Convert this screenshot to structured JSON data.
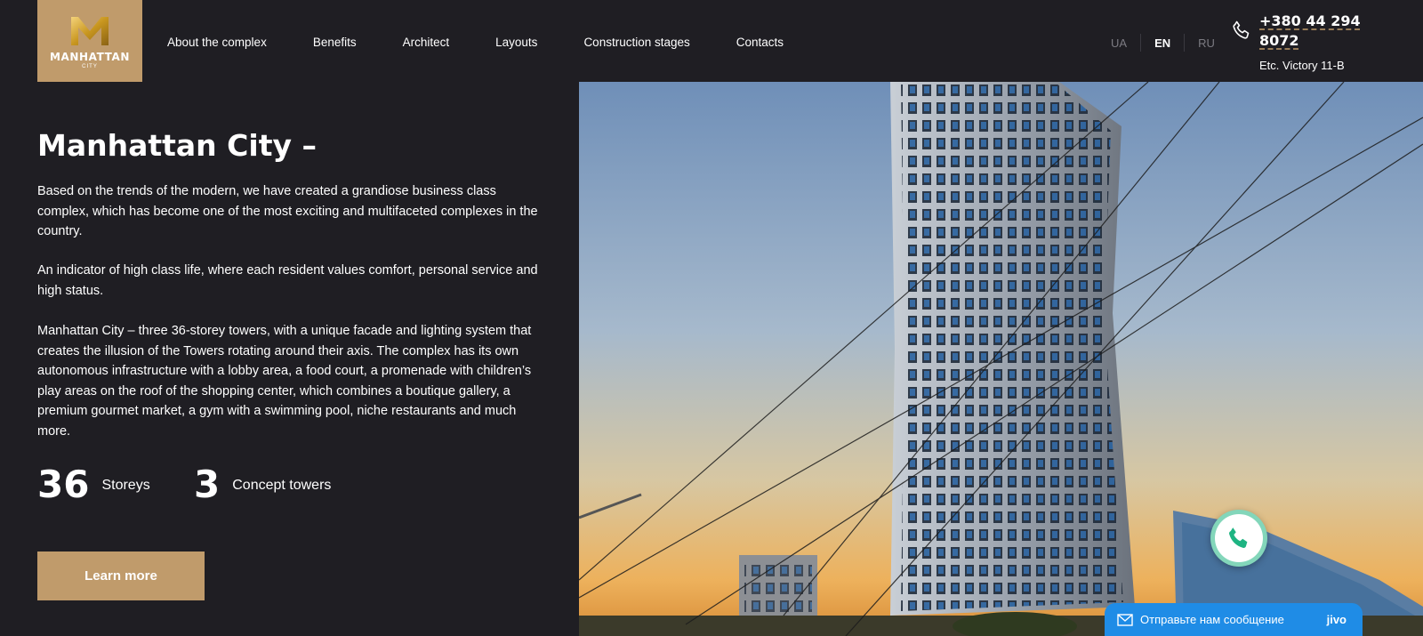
{
  "header": {
    "logo": {
      "word": "MANHATTAN",
      "sub": "CITY",
      "icon": "m-monogram-logo"
    },
    "nav": [
      "About the complex",
      "Benefits",
      "Architect",
      "Layouts",
      "Construction stages",
      "Contacts"
    ],
    "languages": {
      "ua": "UA",
      "en": "EN",
      "ru": "RU",
      "active": "EN"
    },
    "phone": "+380 44 294 8072",
    "address": "Etc. Victory 11-B"
  },
  "main": {
    "title": "Manhattan City –",
    "paragraphs": [
      "Based on the trends of the modern, we have created a grandiose business class complex, which has become one of the most exciting and multifaceted complexes in the country.",
      "An indicator of high class life, where each resident values comfort, personal service and high status.",
      "Manhattan City – three 36-storey towers, with a unique facade and lighting system that creates the illusion of the Towers rotating around their axis. The complex has its own autonomous infrastructure with a lobby area, a food court, a promenade with children’s play areas on the roof of the shopping center, which combines a boutique gallery, a premium gourmet market, a gym with a swimming pool, niche restaurants and much more."
    ],
    "stats": [
      {
        "value": "36",
        "label": "Storeys"
      },
      {
        "value": "3",
        "label": "Concept towers"
      }
    ],
    "cta": "Learn more"
  },
  "widgets": {
    "chat_label": "Отправьте нам сообщение",
    "chat_brand": "jivo",
    "call_icon": "phone-icon"
  },
  "colors": {
    "background": "#1f1e23",
    "accent_gold": "#c09b6b",
    "chat_blue": "#1f8ce6",
    "call_green": "#1eb482"
  }
}
